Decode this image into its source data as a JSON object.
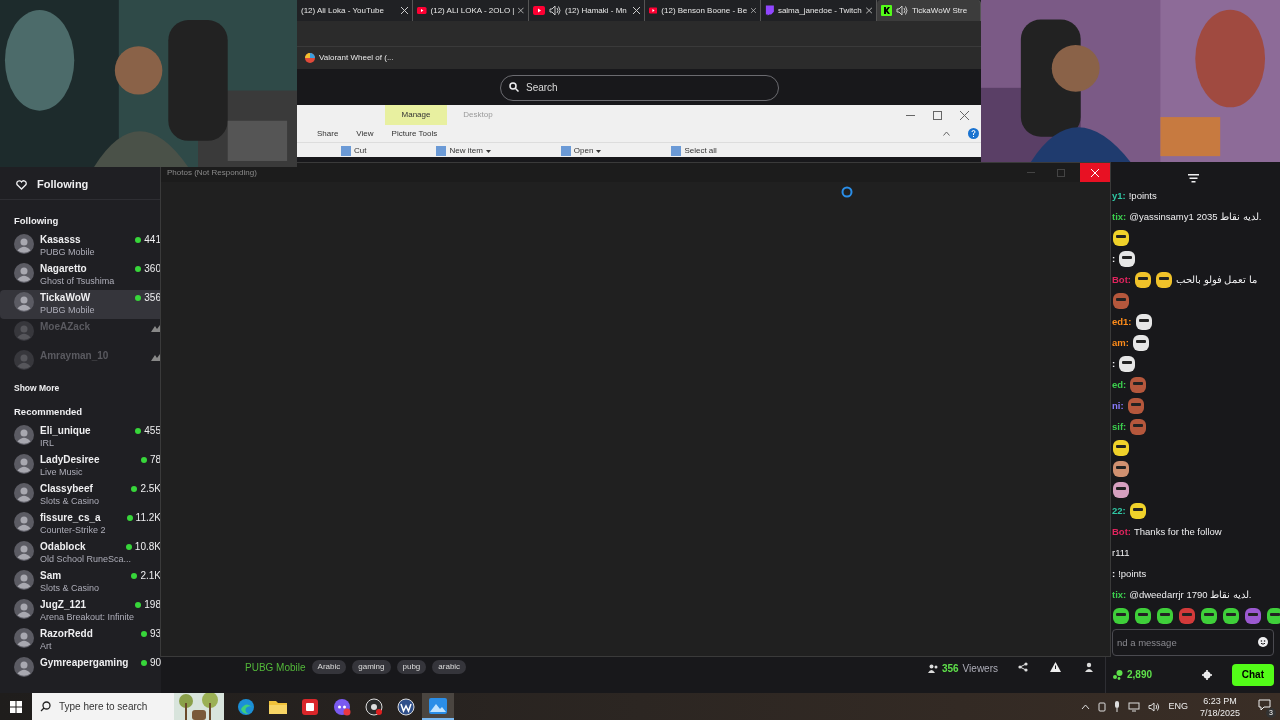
{
  "browser": {
    "tabs": [
      {
        "title": "(12) Ali Loka - YouTube",
        "kind": "none",
        "audio": false,
        "selected": false
      },
      {
        "title": "(12) ALI LOKA - 2OLO |",
        "kind": "youtube",
        "audio": false,
        "selected": false
      },
      {
        "title": "(12) Hamaki - Mn",
        "kind": "youtube",
        "audio": true,
        "selected": false
      },
      {
        "title": "(12) Benson Boone - Be",
        "kind": "youtube",
        "audio": false,
        "selected": false
      },
      {
        "title": "salma_janedoe - Twitch",
        "kind": "twitch",
        "audio": false,
        "selected": false
      },
      {
        "title": "TickaWoW Stre",
        "kind": "kick",
        "audio": true,
        "selected": true
      }
    ],
    "bookmark": "Valorant Wheel of (...",
    "search": {
      "placeholder": "Search"
    }
  },
  "explorer": {
    "ribbon_tabs": [
      {
        "label": "Manage",
        "selected": true
      },
      {
        "label": "Desktop",
        "selected": false
      }
    ],
    "sub_tabs": [
      "Share",
      "View",
      "Picture Tools"
    ],
    "commands": [
      {
        "label": "Cut",
        "kind": "plain"
      },
      {
        "label": "New item",
        "kind": "dropdown"
      },
      {
        "label": "Open",
        "kind": "dropdown"
      },
      {
        "label": "Select all",
        "kind": "plain"
      }
    ]
  },
  "photos_window": {
    "title": "Photos (Not Responding)"
  },
  "sidebar": {
    "header": "Following",
    "sections": [
      {
        "title": "Following",
        "items": [
          {
            "name": "Kasasss",
            "game": "PUBG Mobile",
            "viewers": "441",
            "live": true,
            "selected": false
          },
          {
            "name": "Nagaretto",
            "game": "Ghost of Tsushima",
            "viewers": "360",
            "live": true,
            "selected": false
          },
          {
            "name": "TickaWoW",
            "game": "PUBG Mobile",
            "viewers": "356",
            "live": true,
            "selected": true
          },
          {
            "name": "MoeAZack",
            "live": false,
            "selected": false
          },
          {
            "name": "Amrayman_10",
            "live": false,
            "selected": false
          }
        ],
        "more": "Show More"
      },
      {
        "title": "Recommended",
        "items": [
          {
            "name": "Eli_unique",
            "game": "IRL",
            "viewers": "455",
            "live": true,
            "selected": false
          },
          {
            "name": "LadyDesiree",
            "game": "Live Music",
            "viewers": "78",
            "live": true,
            "selected": false
          },
          {
            "name": "Classybeef",
            "game": "Slots & Casino",
            "viewers": "2.5K",
            "live": true,
            "selected": false
          },
          {
            "name": "fissure_cs_a",
            "game": "Counter-Strike 2",
            "viewers": "11.2K",
            "live": true,
            "selected": false
          },
          {
            "name": "Odablock",
            "game": "Old School RuneSca...",
            "viewers": "10.8K",
            "live": true,
            "selected": false
          },
          {
            "name": "Sam",
            "game": "Slots & Casino",
            "viewers": "2.1K",
            "live": true,
            "selected": false
          },
          {
            "name": "JugZ_121",
            "game": "Arena Breakout: Infinite",
            "viewers": "198",
            "live": true,
            "selected": false
          },
          {
            "name": "RazorRedd",
            "game": "Art",
            "viewers": "93",
            "live": true,
            "selected": false
          },
          {
            "name": "Gymreapergaming",
            "viewers": "90",
            "live": true,
            "selected": false
          }
        ]
      }
    ]
  },
  "stream_info": {
    "game": "PUBG Mobile",
    "tags": [
      "Arabic",
      "gaming",
      "pubg",
      "arabic"
    ],
    "viewer_count": "356",
    "viewer_label": "Viewers"
  },
  "chat": {
    "messages": [
      {
        "user": "y1:",
        "color": "#2fc7a4",
        "text": "!points"
      },
      {
        "user": "tix:",
        "color": "#3ccf4e",
        "text": "@yassinsamy1 2035 لديه نقاط."
      },
      {
        "emotes": [
          {
            "color": "#f0d22a"
          }
        ]
      },
      {
        "user": ":",
        "emotes": [
          {
            "color": "#e6e6e6"
          }
        ]
      },
      {
        "user": "Bot:",
        "color": "#e0245e",
        "emotes": [
          {
            "color": "#f0c22a"
          },
          {
            "color": "#f0c22a"
          }
        ],
        "text": "ما تعمل فولو بالحب"
      },
      {
        "emotes": [
          {
            "color": "#b5573c"
          }
        ]
      },
      {
        "user": "ed1:",
        "color": "#ff8c1a",
        "emotes": [
          {
            "color": "#e6e6e6"
          }
        ]
      },
      {
        "user": "am:",
        "color": "#ff8c1a",
        "emotes": [
          {
            "color": "#e6e6e6"
          }
        ]
      },
      {
        "user": ":",
        "emotes": [
          {
            "color": "#e6e6e6"
          }
        ]
      },
      {
        "user": "ed:",
        "color": "#3ccf4e",
        "emotes": [
          {
            "color": "#b5573c"
          }
        ]
      },
      {
        "user": "ni:",
        "color": "#8a7cff",
        "emotes": [
          {
            "color": "#b5573c"
          }
        ]
      },
      {
        "user": "sif:",
        "color": "#3ccf4e",
        "emotes": [
          {
            "color": "#b5573c"
          }
        ]
      },
      {
        "emotes": [
          {
            "color": "#f0d22a"
          }
        ]
      },
      {
        "emotes": [
          {
            "color": "#d09070"
          }
        ]
      },
      {
        "emotes": [
          {
            "color": "#d6a0c0"
          }
        ]
      },
      {
        "user": "22:",
        "color": "#2fc7a4",
        "emotes": [
          {
            "color": "#f0d22a"
          }
        ]
      },
      {
        "user": "Bot:",
        "color": "#e0245e",
        "text": "Thanks for the follow"
      },
      {
        "text": "r111"
      },
      {
        "user": ":",
        "text": "!points"
      },
      {
        "user": "tix:",
        "color": "#3ccf4e",
        "text": "@dweedarrjr 1790 لديه نقاط."
      }
    ],
    "emote_bar": [
      {
        "color": "#3fcf3a"
      },
      {
        "color": "#3fcf3a"
      },
      {
        "color": "#3fcf3a"
      },
      {
        "color": "#d33a3a"
      },
      {
        "color": "#3fcf3a"
      },
      {
        "color": "#3fcf3a"
      },
      {
        "color": "#9b59d0"
      },
      {
        "color": "#3fcf3a"
      }
    ],
    "input": {
      "placeholder": "nd a message"
    },
    "points": "2,890",
    "send": "Chat"
  },
  "taskbar": {
    "search": {
      "placeholder": "Type here to search"
    },
    "apps": [
      {
        "kind": "edge",
        "active": false
      },
      {
        "kind": "folder",
        "active": false
      },
      {
        "kind": "red",
        "active": false
      },
      {
        "kind": "discord",
        "active": false
      },
      {
        "kind": "obs",
        "active": false
      },
      {
        "kind": "w",
        "active": false
      },
      {
        "kind": "photos",
        "active": true
      }
    ],
    "language": "ENG",
    "time": "6:23 PM",
    "date": "7/18/2025",
    "notifications": "3"
  }
}
